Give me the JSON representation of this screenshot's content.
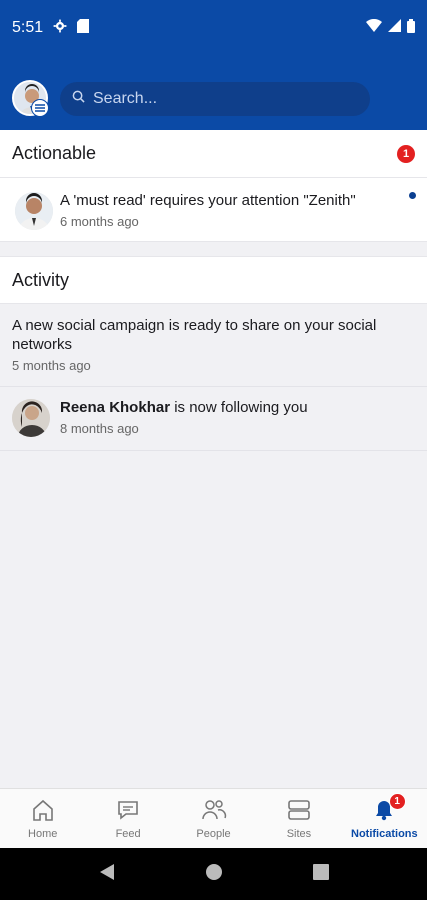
{
  "status_bar": {
    "time": "5:51"
  },
  "search": {
    "placeholder": "Search..."
  },
  "actionable": {
    "title": "Actionable",
    "count": "1",
    "items": [
      {
        "text": "A 'must read' requires your attention \"Zenith\"",
        "time": "6 months ago",
        "unread": true
      }
    ]
  },
  "activity": {
    "title": "Activity",
    "items": [
      {
        "text": "A new social campaign is ready to share on your social networks",
        "time": "5 months ago"
      },
      {
        "name": "Reena Khokhar",
        "text": " is now following you",
        "time": "8 months ago"
      }
    ]
  },
  "bottom_nav": {
    "items": [
      {
        "label": "Home",
        "icon": "home-icon"
      },
      {
        "label": "Feed",
        "icon": "feed-icon"
      },
      {
        "label": "People",
        "icon": "people-icon"
      },
      {
        "label": "Sites",
        "icon": "sites-icon"
      },
      {
        "label": "Notifications",
        "icon": "bell-icon",
        "badge": "1",
        "active": true
      }
    ]
  },
  "colors": {
    "brand": "#0b4aa6",
    "badge": "#e32020"
  }
}
